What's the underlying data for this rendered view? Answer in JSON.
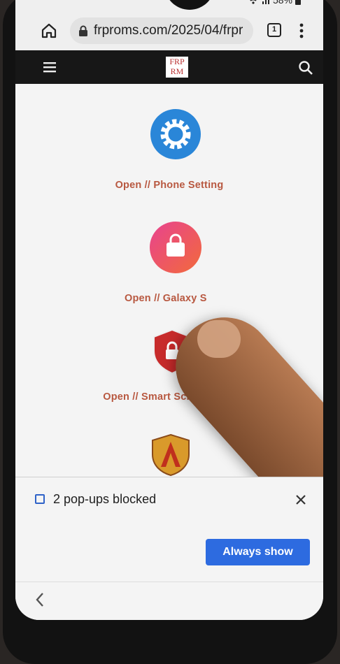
{
  "status": {
    "battery": "58%"
  },
  "browser": {
    "url": "frproms.com/2025/04/frpr",
    "tab_count": "1"
  },
  "site": {
    "logo_text": "FRP RM"
  },
  "items": [
    {
      "label": "Open // Phone Setting"
    },
    {
      "label": "Open // Galaxy S"
    },
    {
      "label": "Open // Smart Screen Lock"
    }
  ],
  "popup": {
    "message": "2 pop-ups blocked",
    "button": "Always show"
  },
  "colors": {
    "accent": "#2d6be0",
    "label": "#b85840",
    "site_bar": "#171717"
  }
}
